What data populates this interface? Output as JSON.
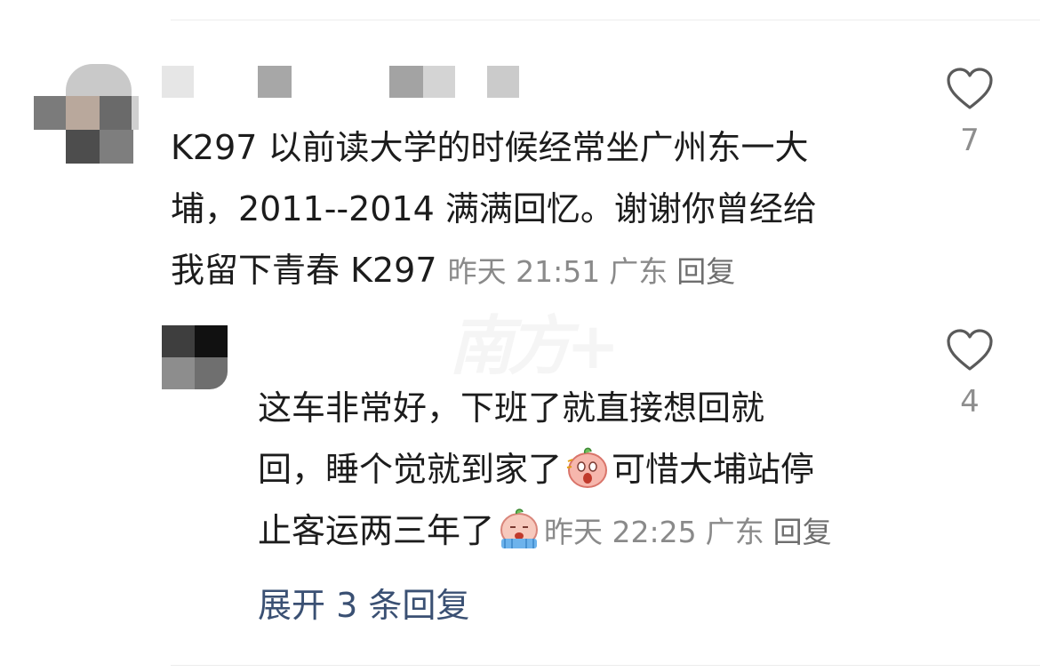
{
  "comment1": {
    "text": "K297 以前读大学的时候经常坐广州东一大\n埔，2011--2014 满满回忆。谢谢你曾经给\n我留下青春 K297 ",
    "time": "昨天 21:51",
    "location": "广东",
    "reply_label": "回复",
    "like_count": "7"
  },
  "reply1": {
    "text_part1": "这车非常好，下班了就直接想回就\n回，睡个觉就到家了",
    "text_part2": "可惜大埔站停\n止客运两三年了",
    "time": "昨天 22:25",
    "location": "广东",
    "reply_label": "回复",
    "like_count": "4"
  },
  "expand_label": "展开 3 条回复",
  "colors": {
    "expand_link": "#3a5073",
    "meta_text": "#8a8a8a",
    "like_icon": "#5a5a5a"
  }
}
